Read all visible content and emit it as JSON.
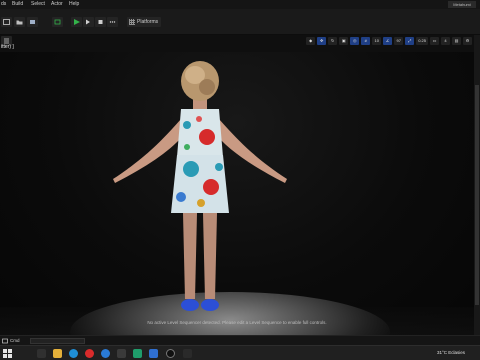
{
  "menubar": {
    "items": [
      "ds",
      "Build",
      "Select",
      "Actor",
      "Help"
    ],
    "app_title": "Metahumi"
  },
  "toolbar": {
    "platforms_label": "Platforms"
  },
  "viewport": {
    "label": "itter) ]",
    "chips": [
      "10",
      "97",
      "0.25",
      "4"
    ],
    "status_message": "No active Level Sequencer detected. Please edit a Level Sequence to enable full controls."
  },
  "bottom_panel": {
    "drawer_label": "Cmd"
  },
  "taskbar": {
    "weather": "31°C  Eclasies"
  },
  "colors": {
    "play": "#33b34a",
    "dress_base": "#d9e6ea",
    "accent_red": "#d62b2b",
    "accent_teal": "#2a9bb5",
    "shoes": "#2c4fd6"
  }
}
